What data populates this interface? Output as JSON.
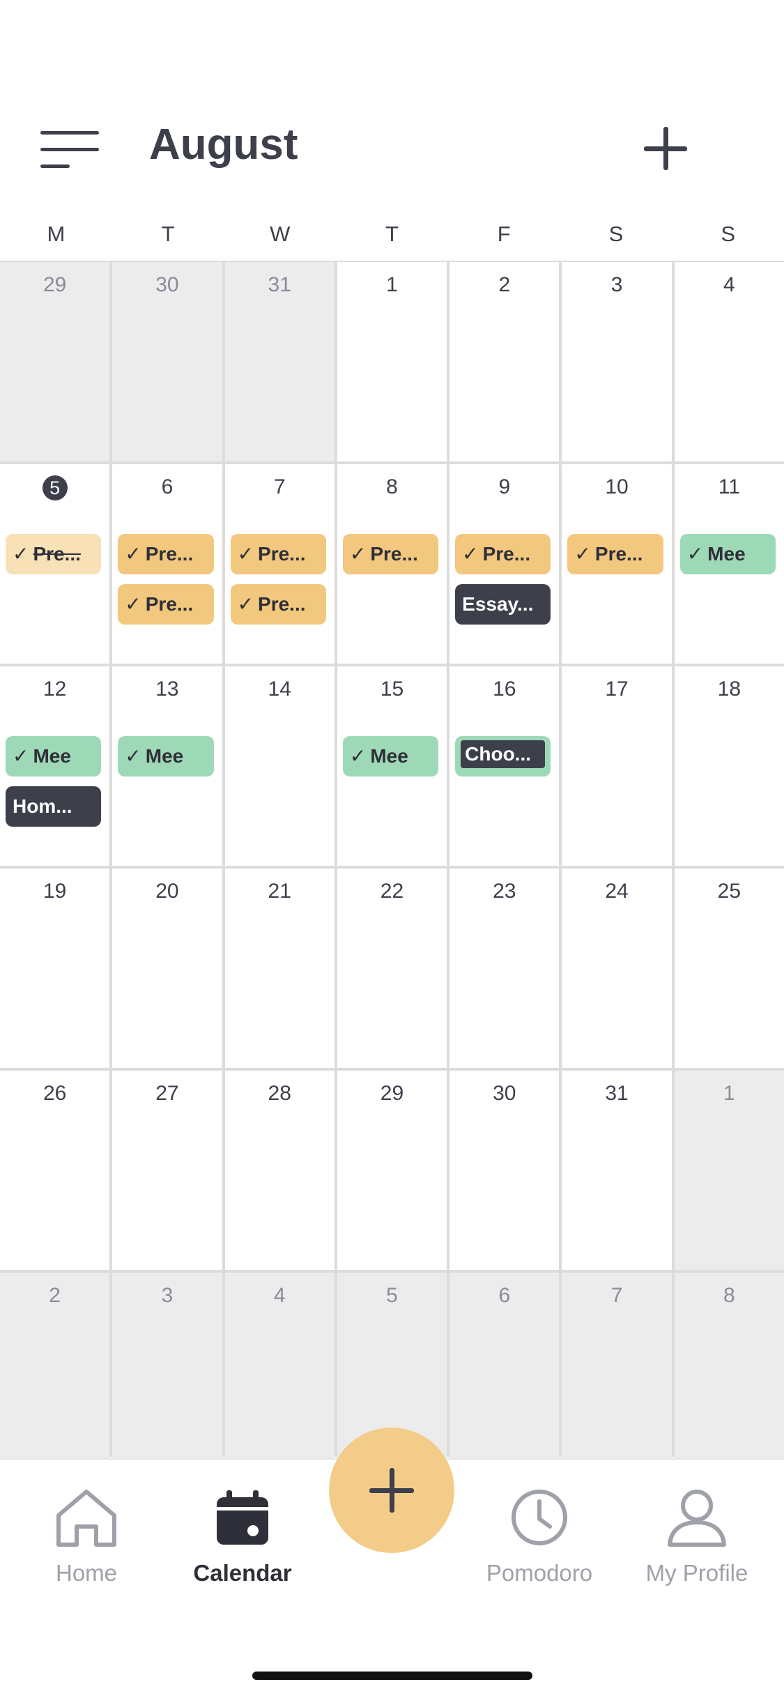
{
  "header": {
    "month": "August",
    "menu_icon": "hamburger-menu-icon",
    "add_icon": "plus-icon"
  },
  "weekdays": [
    "M",
    "T",
    "W",
    "T",
    "F",
    "S",
    "S"
  ],
  "weeks": [
    [
      {
        "day": "29",
        "other": true
      },
      {
        "day": "30",
        "other": true
      },
      {
        "day": "31",
        "other": true
      },
      {
        "day": "1"
      },
      {
        "day": "2"
      },
      {
        "day": "3"
      },
      {
        "day": "4"
      }
    ],
    [
      {
        "day": "5",
        "today": true,
        "events": [
          {
            "text": "Pre...",
            "check": true,
            "style": "orange-light"
          }
        ]
      },
      {
        "day": "6",
        "events": [
          {
            "text": "Pre...",
            "check": true,
            "style": "orange"
          },
          {
            "text": "Pre...",
            "check": true,
            "style": "orange"
          }
        ]
      },
      {
        "day": "7",
        "events": [
          {
            "text": "Pre...",
            "check": true,
            "style": "orange"
          },
          {
            "text": "Pre...",
            "check": true,
            "style": "orange"
          }
        ]
      },
      {
        "day": "8",
        "events": [
          {
            "text": "Pre...",
            "check": true,
            "style": "orange"
          }
        ]
      },
      {
        "day": "9",
        "events": [
          {
            "text": "Pre...",
            "check": true,
            "style": "orange"
          },
          {
            "text": "Essay...",
            "check": false,
            "style": "dark"
          }
        ]
      },
      {
        "day": "10",
        "events": [
          {
            "text": "Pre...",
            "check": true,
            "style": "orange"
          }
        ]
      },
      {
        "day": "11",
        "events": [
          {
            "text": "Mee",
            "check": true,
            "style": "green"
          }
        ]
      }
    ],
    [
      {
        "day": "12",
        "events": [
          {
            "text": "Mee",
            "check": true,
            "style": "green"
          },
          {
            "text": "Hom...",
            "check": false,
            "style": "dark"
          }
        ]
      },
      {
        "day": "13",
        "events": [
          {
            "text": "Mee",
            "check": true,
            "style": "green"
          }
        ]
      },
      {
        "day": "14"
      },
      {
        "day": "15",
        "events": [
          {
            "text": "Mee",
            "check": true,
            "style": "green"
          }
        ]
      },
      {
        "day": "16",
        "events": [
          {
            "text": "Choo...",
            "check": false,
            "style": "green-dark"
          }
        ]
      },
      {
        "day": "17"
      },
      {
        "day": "18"
      }
    ],
    [
      {
        "day": "19"
      },
      {
        "day": "20"
      },
      {
        "day": "21"
      },
      {
        "day": "22"
      },
      {
        "day": "23"
      },
      {
        "day": "24"
      },
      {
        "day": "25"
      }
    ],
    [
      {
        "day": "26"
      },
      {
        "day": "27"
      },
      {
        "day": "28"
      },
      {
        "day": "29"
      },
      {
        "day": "30"
      },
      {
        "day": "31"
      },
      {
        "day": "1",
        "other": true
      }
    ],
    [
      {
        "day": "2",
        "other": true
      },
      {
        "day": "3",
        "other": true
      },
      {
        "day": "4",
        "other": true
      },
      {
        "day": "5",
        "other": true
      },
      {
        "day": "6",
        "other": true
      },
      {
        "day": "7",
        "other": true
      },
      {
        "day": "8",
        "other": true
      }
    ]
  ],
  "nav": {
    "home": "Home",
    "calendar": "Calendar",
    "pomodoro": "Pomodoro",
    "profile": "My Profile",
    "active": "calendar"
  },
  "colors": {
    "accent_orange": "#f2c77e",
    "accent_green": "#9ed9b7",
    "dark": "#3d3f4b",
    "fab": "#f2cc88"
  }
}
